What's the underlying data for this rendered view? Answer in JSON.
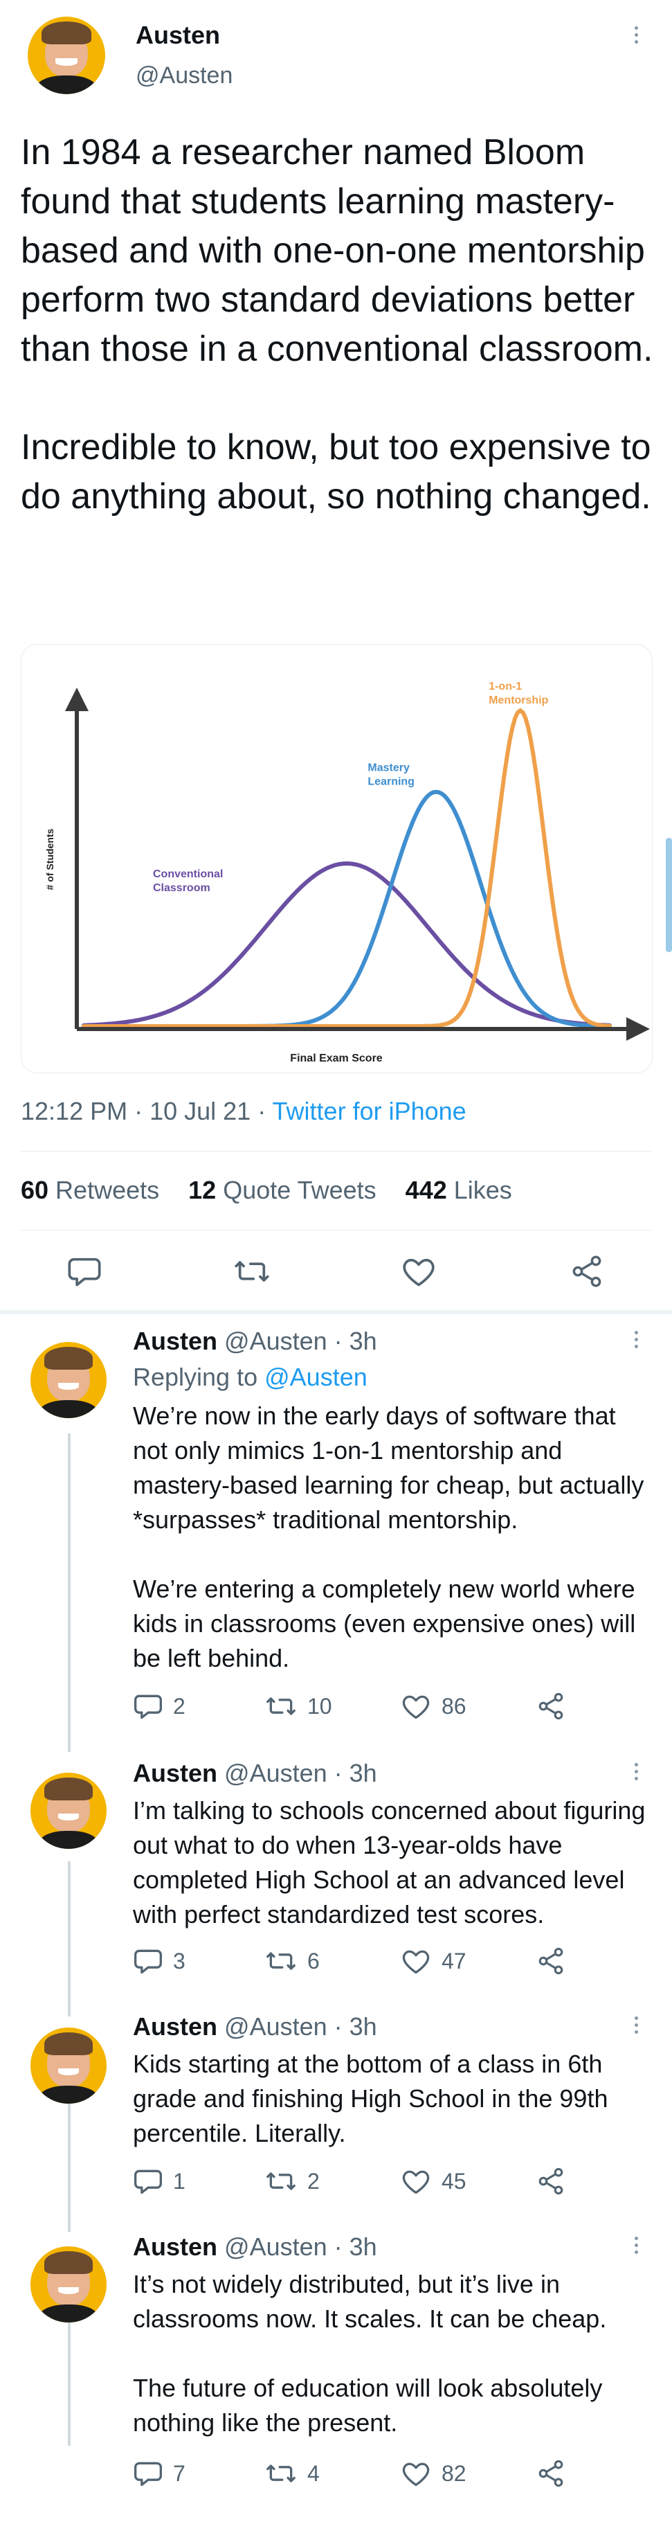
{
  "main_tweet": {
    "author_name": "Austen",
    "handle": "@Austen",
    "text": "In 1984 a researcher named Bloom found that students learning mastery-based and with one-on-one mentorship perform two standard deviations better than those in a conventional classroom.\n\nIncredible to know, but too expensive to do anything about, so nothing changed.",
    "timestamp": "12:12 PM · 10 Jul 21 · ",
    "source": "Twitter for iPhone",
    "stats": {
      "retweets_count": "60",
      "retweets_label": " Retweets",
      "quotes_count": "12",
      "quotes_label": " Quote Tweets",
      "likes_count": "442",
      "likes_label": " Likes"
    }
  },
  "chart_data": {
    "type": "area",
    "xlabel": "Final Exam Score",
    "ylabel": "# of Students",
    "series": [
      {
        "name": "Conventional Classroom",
        "label_lines": [
          "Conventional",
          "Classroom"
        ],
        "color": "#6a4fa3",
        "mean": 0.5,
        "sd": 0.155,
        "peak": 0.5
      },
      {
        "name": "Mastery Learning",
        "label_lines": [
          "Mastery",
          "Learning"
        ],
        "color": "#3f8fd0",
        "mean": 0.67,
        "sd": 0.085,
        "peak": 0.72
      },
      {
        "name": "1-on-1 Mentorship",
        "label_lines": [
          "1-on-1",
          "Mentorship"
        ],
        "color": "#f0a04a",
        "mean": 0.83,
        "sd": 0.045,
        "peak": 0.97
      }
    ],
    "axis_color": "#3a3a3a",
    "grid": false
  },
  "replies": [
    {
      "name": "Austen",
      "meta": " @Austen · 3h",
      "replying_prefix": "Replying to ",
      "replying_to": "@Austen",
      "text": "We’re now in the early days of software that not only mimics 1-on-1 mentorship and mastery-based learning for cheap, but actually *surpasses* traditional mentorship.\n\nWe’re entering a completely new world where kids in classrooms (even expensive ones) will be left behind.",
      "replies": "2",
      "retweets": "10",
      "likes": "86"
    },
    {
      "name": "Austen",
      "meta": " @Austen · 3h",
      "text": "I’m talking to schools concerned about figuring out what to do  when 13-year-olds have completed High School at an advanced level with perfect standardized test scores.",
      "replies": "3",
      "retweets": "6",
      "likes": "47"
    },
    {
      "name": "Austen",
      "meta": " @Austen · 3h",
      "text": "Kids starting at the bottom of a class in 6th grade and finishing High School in the 99th percentile. Literally.",
      "replies": "1",
      "retweets": "2",
      "likes": "45"
    },
    {
      "name": "Austen",
      "meta": " @Austen · 3h",
      "text": "It’s not widely distributed, but it’s live in classrooms now. It scales. It can be cheap.\n\nThe future of education will look absolutely nothing like the present.",
      "replies": "7",
      "retweets": "4",
      "likes": "82"
    }
  ],
  "icons": {
    "reply": "speech-bubble-icon",
    "retweet": "retweet-arrows-icon",
    "like": "heart-icon",
    "share": "share-nodes-icon",
    "more": "more-dots-icon"
  }
}
